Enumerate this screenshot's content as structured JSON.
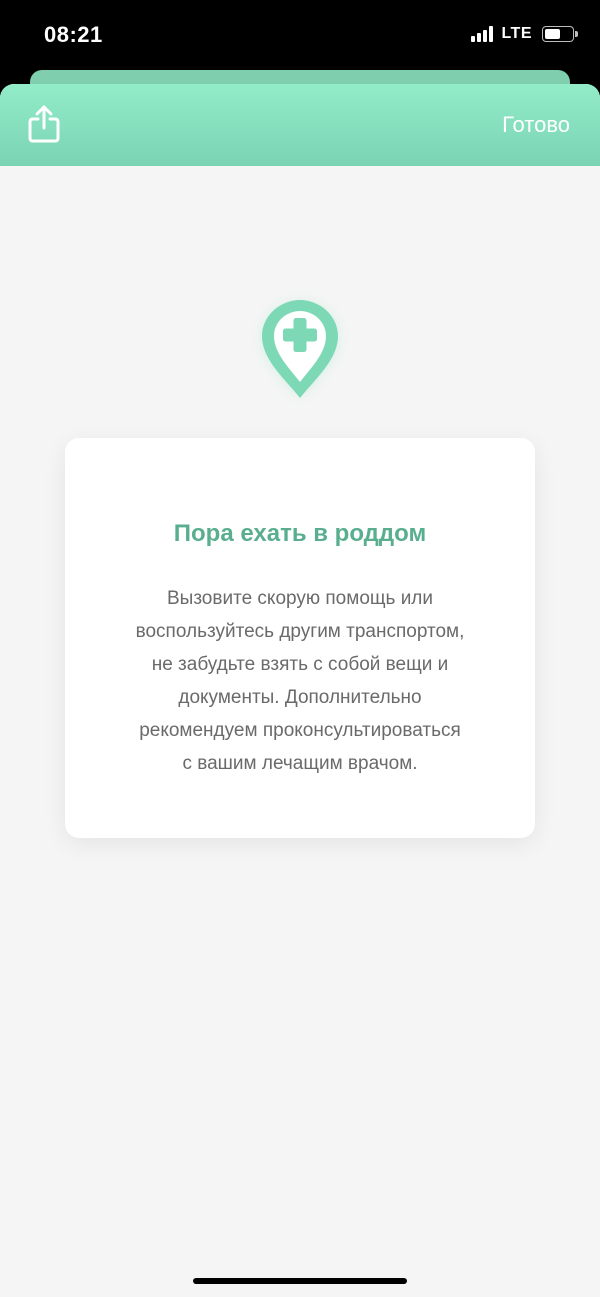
{
  "status_bar": {
    "time": "08:21",
    "network": "LTE",
    "battery_level": 0.6
  },
  "nav": {
    "share_icon": "share-icon",
    "done_label": "Готово"
  },
  "card": {
    "icon": "location-pin-plus-icon",
    "title": "Пора ехать в роддом",
    "lines": [
      "Вызовите скорую помощь или",
      "воспользуйтесь другим транспортом,",
      "не забудьте взять с собой вещи и",
      "документы. Дополнительно",
      "рекомендуем проконсультироваться",
      "с вашим лечащим врачом."
    ]
  },
  "colors": {
    "accent": "#7ad3b3",
    "title": "#5aae90",
    "text": "#6a6a6a",
    "background": "#f5f5f5"
  }
}
